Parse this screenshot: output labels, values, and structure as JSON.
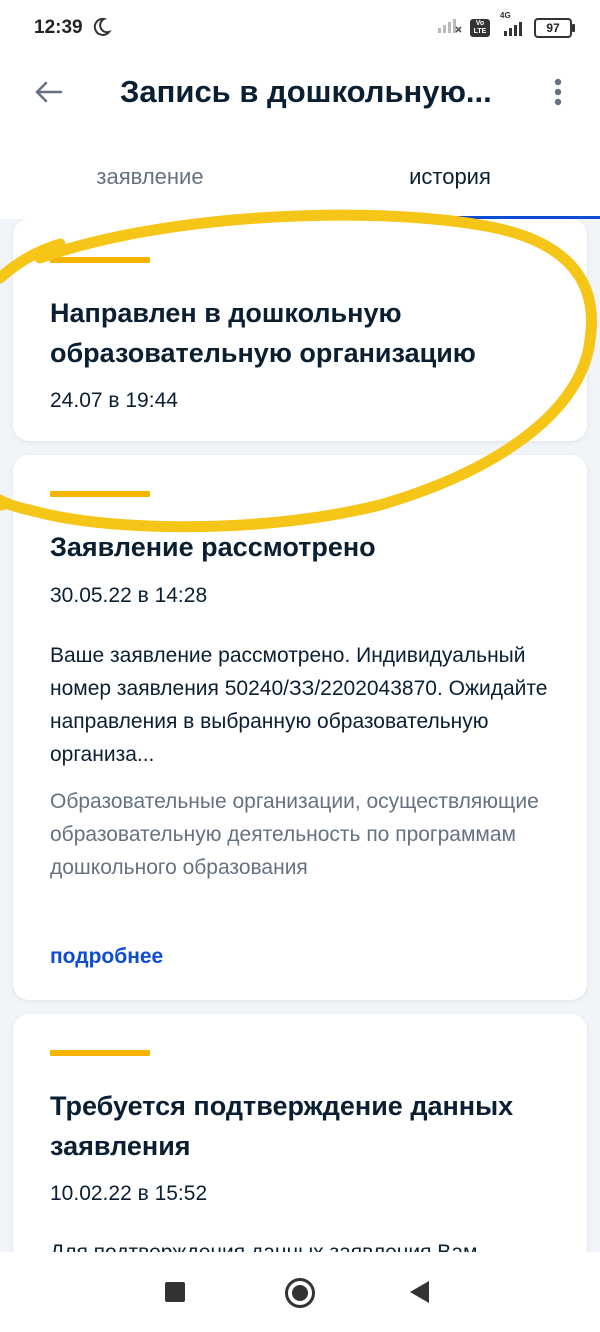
{
  "status_bar": {
    "time": "12:39",
    "network_label": "4G",
    "volte_label": "Vo LTE",
    "battery": "97"
  },
  "app_bar": {
    "title": "Запись в дошкольную..."
  },
  "tabs": [
    {
      "label": "заявление",
      "active": false
    },
    {
      "label": "история",
      "active": true
    }
  ],
  "history": [
    {
      "title": "Направлен в дошкольную образовательную организацию",
      "date": "24.07 в 19:44"
    },
    {
      "title": "Заявление рассмотрено",
      "date": "30.05.22 в 14:28",
      "text": "Ваше заявление рассмотрено. Индивидуальный номер заявления 50240/ЗЗ/2202043870. Ожидайте направления в выбранную образовательную организа...",
      "organization": "Образовательные организации, осуществляющие образовательную деятельность по программам дошкольного образования",
      "link": "подробнее"
    },
    {
      "title": "Требуется подтверждение данных заявления",
      "date": "10.02.22 в 15:52",
      "text": "Для подтверждения данных заявления Вам"
    }
  ],
  "colors": {
    "accent_line": "#f4b400",
    "highlight_scribble": "#f5c518",
    "link": "#0d4cd3",
    "tab_indicator": "#0d4cd3"
  },
  "icons": [
    "moon-icon",
    "signal-icon",
    "volte-icon",
    "battery-icon",
    "back-arrow-icon",
    "more-vertical-icon",
    "recent-apps-icon",
    "home-icon",
    "back-triangle-icon"
  ]
}
